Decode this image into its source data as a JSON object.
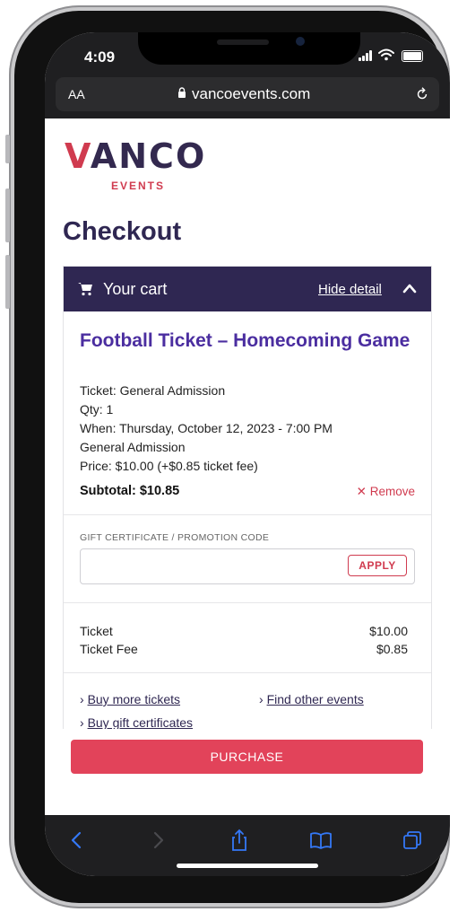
{
  "status": {
    "time": "4:09"
  },
  "browser": {
    "aa_label": "AA",
    "domain": "vancoevents.com"
  },
  "logo": {
    "main": "VANCO",
    "sub": "EVENTS"
  },
  "page": {
    "title": "Checkout"
  },
  "cart": {
    "label": "Your cart",
    "toggle_label": "Hide detail",
    "item": {
      "title": "Football Ticket – Homecoming Game",
      "ticket": "Ticket: General Admission",
      "qty": "Qty: 1",
      "when": "When: Thursday, October 12, 2023 - 7:00 PM",
      "admission": "General Admission",
      "price": "Price: $10.00 (+$0.85 ticket fee)",
      "subtotal": "Subtotal: $10.85",
      "remove_label": "✕ Remove"
    }
  },
  "promo": {
    "label": "GIFT CERTIFICATE / PROMOTION CODE",
    "value": "",
    "apply_label": "APPLY"
  },
  "summary": [
    {
      "label": "Ticket",
      "value": "$10.00"
    },
    {
      "label": "Ticket Fee",
      "value": "$0.85"
    }
  ],
  "links": {
    "buy_more": "Buy more tickets",
    "find_other": "Find other events",
    "gift_certs": "Buy gift certificates"
  },
  "purchase_label": "PURCHASE",
  "colors": {
    "brand_dark": "#2f2752",
    "brand_red": "#d03b4f",
    "title_purple": "#4b2ea0",
    "purchase": "#e2435a"
  }
}
